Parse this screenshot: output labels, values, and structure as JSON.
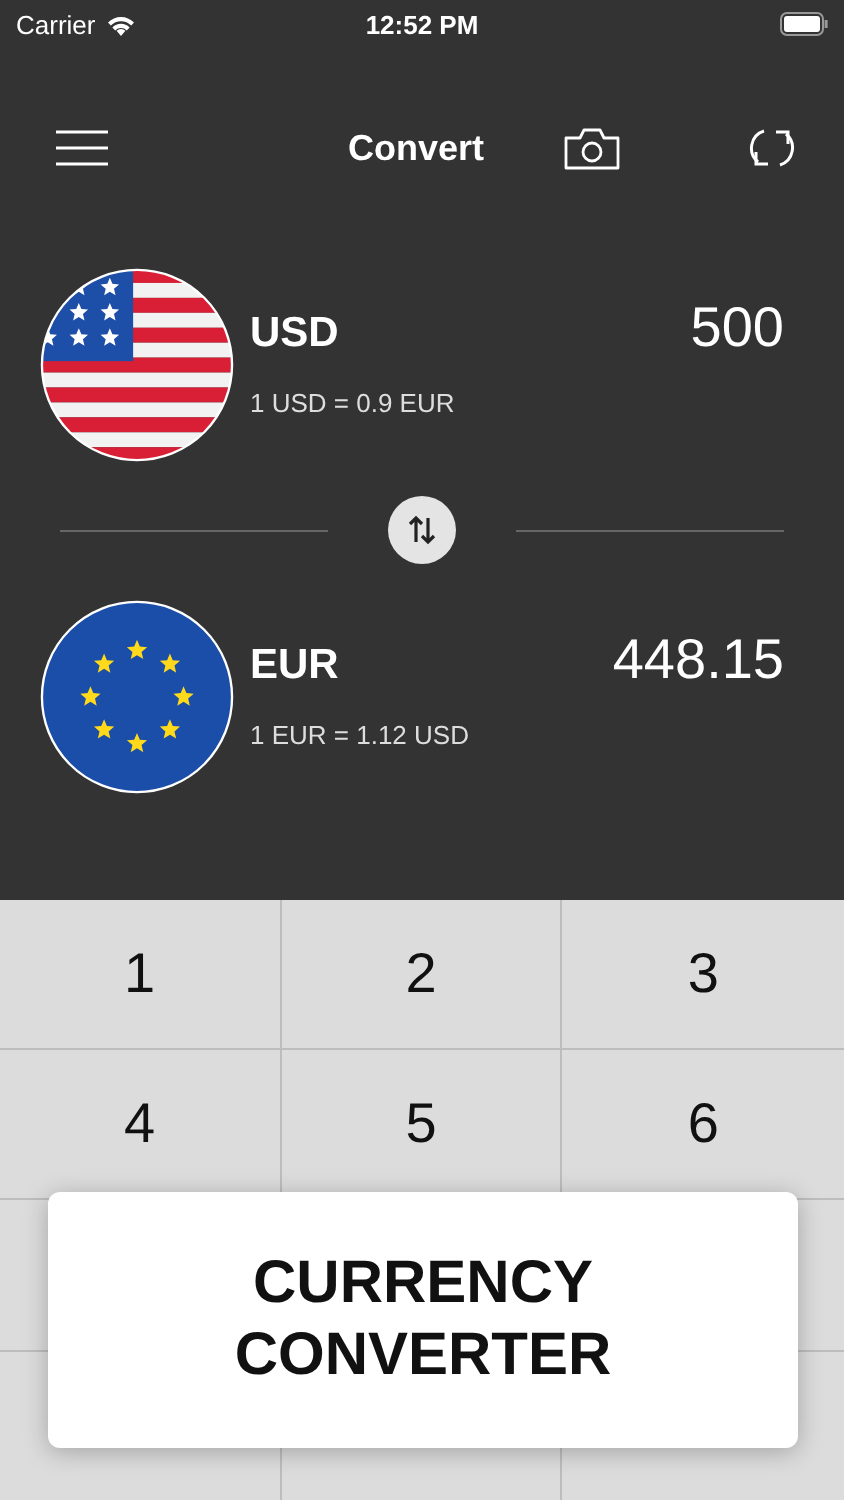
{
  "status_bar": {
    "carrier": "Carrier",
    "time": "12:52 PM"
  },
  "header": {
    "title": "Convert"
  },
  "currencies": [
    {
      "kind": "us",
      "code": "USD",
      "amount": "500",
      "rate": "1 USD = 0.9 EUR"
    },
    {
      "kind": "eu",
      "code": "EUR",
      "amount": "448.15",
      "rate": "1 EUR = 1.12 USD"
    }
  ],
  "keypad": [
    "1",
    "2",
    "3",
    "4",
    "5",
    "6"
  ],
  "banner": {
    "text": "CURRENCY CONVERTER"
  }
}
